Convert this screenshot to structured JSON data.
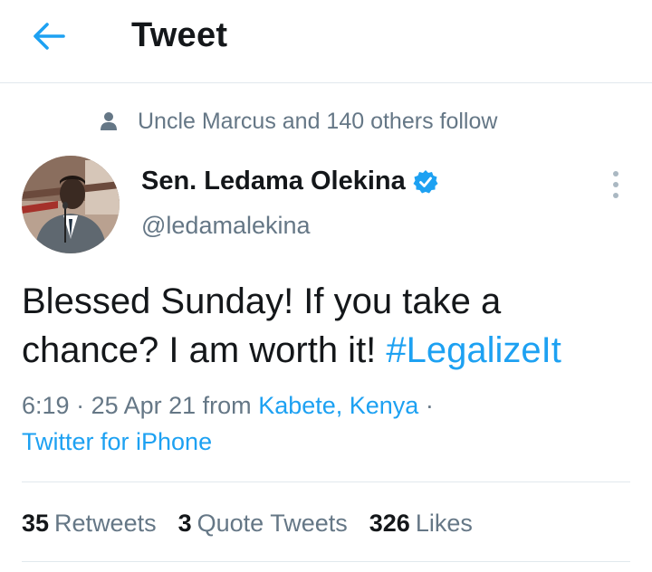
{
  "header": {
    "title": "Tweet",
    "back_icon": "arrow-left-icon"
  },
  "social_context": {
    "icon": "person-icon",
    "text": "Uncle Marcus and 140 others follow"
  },
  "author": {
    "display_name": "Sen. Ledama Olekina",
    "handle": "@ledamalekina",
    "verified": true
  },
  "tweet": {
    "text": "Blessed Sunday! If you take a chance? I am worth it!",
    "hashtag": "#LegalizeIt"
  },
  "meta": {
    "time": "6:19",
    "date": "25 Apr 21",
    "from_label": "from",
    "location": "Kabete, Kenya",
    "source": "Twitter for iPhone"
  },
  "stats": {
    "retweets_count": "35",
    "retweets_label": "Retweets",
    "quotes_count": "3",
    "quotes_label": "Quote Tweets",
    "likes_count": "326",
    "likes_label": "Likes"
  },
  "colors": {
    "accent": "#1da1f2",
    "text_primary": "#14171a",
    "text_secondary": "#657786",
    "divider": "#e1e8ed"
  }
}
